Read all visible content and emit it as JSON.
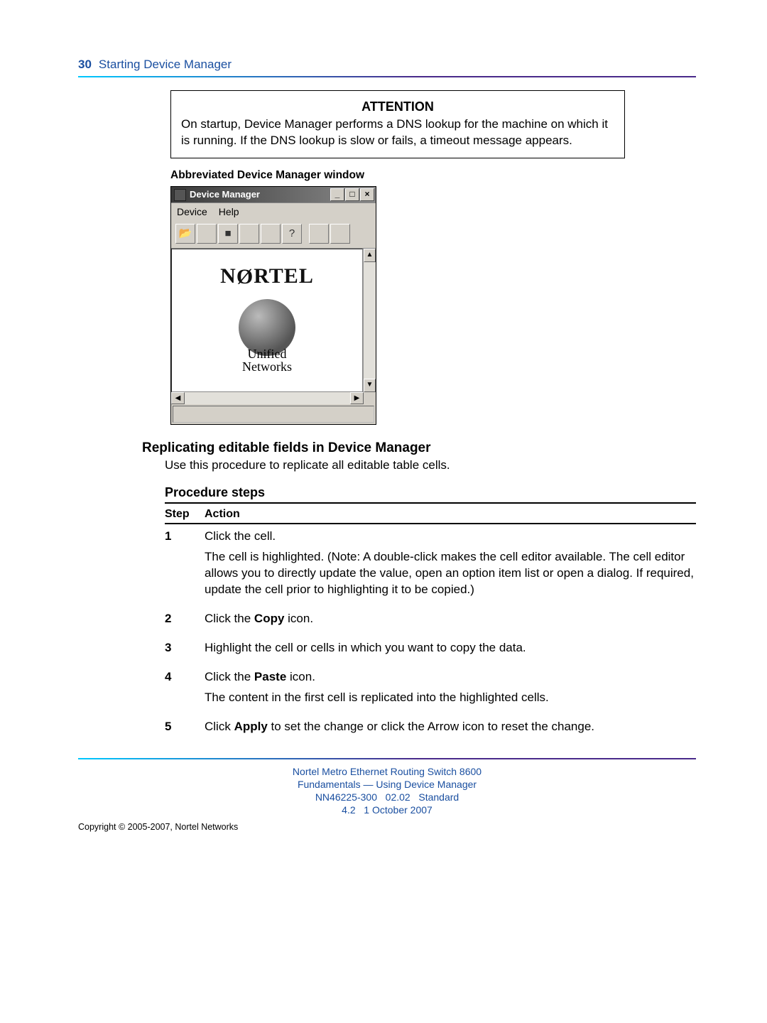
{
  "page_number": "30",
  "header_title": "Starting Device Manager",
  "attention": {
    "title": "ATTENTION",
    "body": "On startup, Device Manager performs a DNS lookup for the machine on which it is running. If the DNS lookup is slow or fails, a timeout message appears."
  },
  "figure_caption": "Abbreviated Device Manager window",
  "dm_window": {
    "title": "Device Manager",
    "menu": {
      "device": "Device",
      "help": "Help"
    },
    "logo_text_pre": "N",
    "logo_text_mid": "Ø",
    "logo_text_post": "RTEL",
    "tagline_line1": "Unified",
    "tagline_line2": "Networks",
    "ctrl_min": "_",
    "ctrl_max": "□",
    "ctrl_close": "×",
    "tb_open": "📂",
    "tb_stop": "■",
    "tb_help": "?",
    "vscroll_up": "▲",
    "vscroll_down": "▼",
    "hscroll_left": "◀",
    "hscroll_right": "▶"
  },
  "section_heading": "Replicating editable fields in Device Manager",
  "section_intro": "Use this procedure to replicate all editable table cells.",
  "procedure": {
    "title": "Procedure steps",
    "col_step": "Step",
    "col_action": "Action",
    "rows": [
      {
        "num": "1",
        "p1": "Click the cell.",
        "p2": "The cell is highlighted. (Note: A double-click makes the cell editor available. The cell editor allows you to directly update the value, open an option item list or open a dialog. If required, update the cell prior to highlighting it to be copied.)"
      },
      {
        "num": "2",
        "p1_pre": "Click the ",
        "p1_bold": "Copy",
        "p1_post": " icon."
      },
      {
        "num": "3",
        "p1": "Highlight the cell or cells in which you want to copy the data."
      },
      {
        "num": "4",
        "p1_pre": "Click the ",
        "p1_bold": "Paste",
        "p1_post": " icon.",
        "p2": "The content in the first cell is replicated into the highlighted cells."
      },
      {
        "num": "5",
        "p1_pre": "Click ",
        "p1_bold": "Apply",
        "p1_post": " to set the change or click the Arrow icon to reset the change."
      }
    ]
  },
  "footer": {
    "line1": "Nortel Metro Ethernet Routing Switch 8600",
    "line2": "Fundamentals — Using Device Manager",
    "line3": "NN46225-300   02.02   Standard",
    "line4": "4.2   1 October 2007",
    "copyright": "Copyright © 2005-2007, Nortel Networks"
  }
}
